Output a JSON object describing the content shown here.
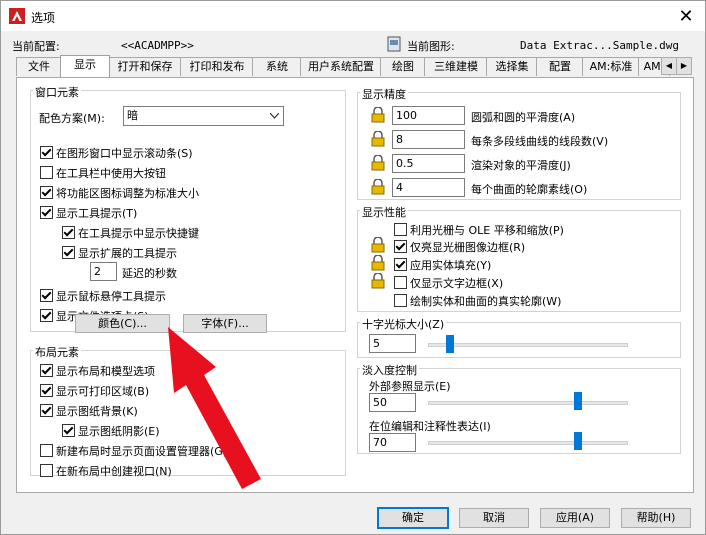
{
  "window": {
    "title": "选项",
    "close_glyph": "✕"
  },
  "header": {
    "current_profile_label": "当前配置:",
    "current_profile_value": "<<ACADMPP>>",
    "current_drawing_label": "当前图形:",
    "current_drawing_value": "Data Extrac...Sample.dwg"
  },
  "tabs": [
    "文件",
    "显示",
    "打开和保存",
    "打印和发布",
    "系统",
    "用户系统配置",
    "绘图",
    "三维建模",
    "选择集",
    "配置",
    "AM:标准",
    "AM:"
  ],
  "active_tab": "显示",
  "window_elements": {
    "title": "窗口元素",
    "color_scheme_label": "配色方案(M):",
    "color_scheme_value": "暗",
    "checkboxes": [
      {
        "label": "在图形窗口中显示滚动条(S)",
        "checked": true
      },
      {
        "label": "在工具栏中使用大按钮",
        "checked": false
      },
      {
        "label": "将功能区图标调整为标准大小",
        "checked": true
      },
      {
        "label": "显示工具提示(T)",
        "checked": true
      },
      {
        "label": "在工具提示中显示快捷键",
        "checked": true
      },
      {
        "label": "显示扩展的工具提示",
        "checked": true
      },
      {
        "label": "显示鼠标悬停工具提示",
        "checked": true
      },
      {
        "label": "显示文件选项卡(S)",
        "checked": true
      }
    ],
    "delay_value": "2",
    "delay_label": "延迟的秒数",
    "colors_button": "颜色(C)...",
    "fonts_button": "字体(F)..."
  },
  "layout_elements": {
    "title": "布局元素",
    "checkboxes": [
      {
        "label": "显示布局和模型选项",
        "checked": true
      },
      {
        "label": "显示可打印区域(B)",
        "checked": true
      },
      {
        "label": "显示图纸背景(K)",
        "checked": true
      },
      {
        "label": "显示图纸阴影(E)",
        "checked": true
      },
      {
        "label": "新建布局时显示页面设置管理器(G)",
        "checked": false
      },
      {
        "label": "在新布局中创建视口(N)",
        "checked": false
      }
    ]
  },
  "display_resolution": {
    "title": "显示精度",
    "rows": [
      {
        "value": "100",
        "label": "圆弧和圆的平滑度(A)"
      },
      {
        "value": "8",
        "label": "每条多段线曲线的线段数(V)"
      },
      {
        "value": "0.5",
        "label": "渲染对象的平滑度(J)"
      },
      {
        "value": "4",
        "label": "每个曲面的轮廓素线(O)"
      }
    ]
  },
  "display_performance": {
    "title": "显示性能",
    "checkboxes": [
      {
        "label": "利用光栅与 OLE 平移和缩放(P)",
        "checked": false
      },
      {
        "label": "仅亮显光栅图像边框(R)",
        "checked": true
      },
      {
        "label": "应用实体填充(Y)",
        "checked": true
      },
      {
        "label": "仅显示文字边框(X)",
        "checked": false
      },
      {
        "label": "绘制实体和曲面的真实轮廓(W)",
        "checked": false
      }
    ]
  },
  "crosshair": {
    "title": "十字光标大小(Z)",
    "value": "5",
    "level": 5
  },
  "fade": {
    "title": "淡入度控制",
    "xref_label": "外部参照显示(E)",
    "xref_value": "50",
    "xref_level": 50,
    "inplace_label": "在位编辑和注释性表达(I)",
    "inplace_value": "70",
    "inplace_level": 70
  },
  "buttons": {
    "ok": "确定",
    "cancel": "取消",
    "apply": "应用(A)",
    "help": "帮助(H)"
  },
  "colors": {
    "accent": "#0078d7",
    "arrow": "#e8101e",
    "autocad_red": "#cc1f1f"
  }
}
